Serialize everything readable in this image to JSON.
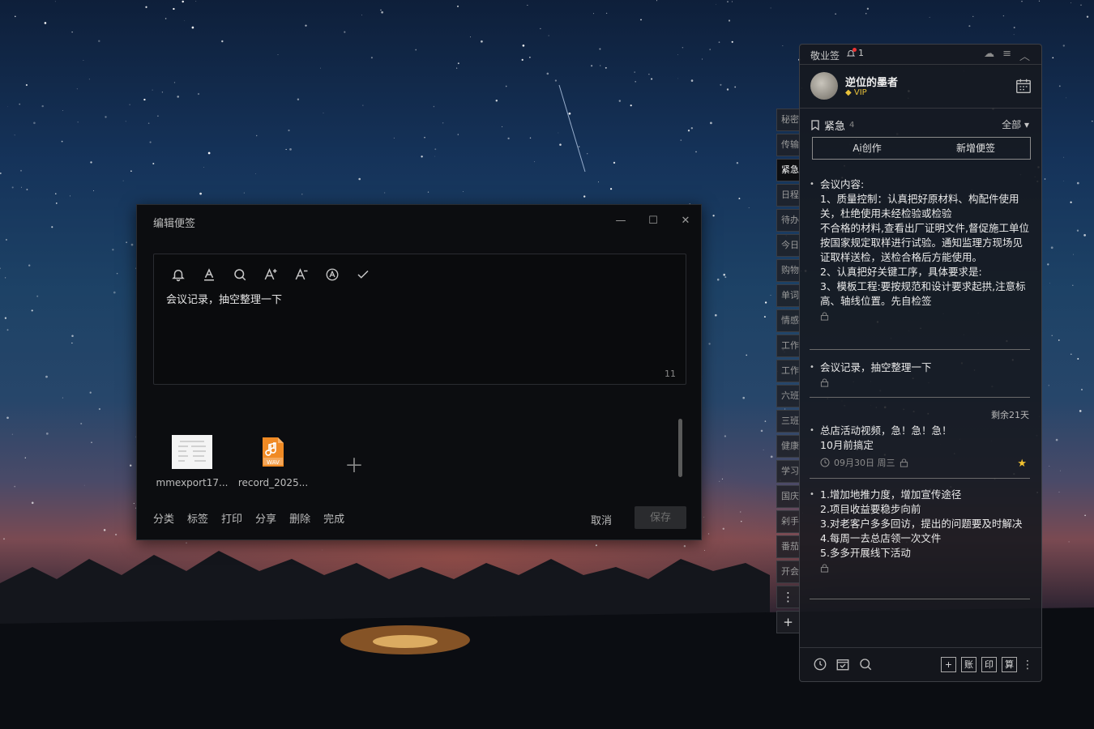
{
  "editor": {
    "title": "编辑便签",
    "text": "会议记录，抽空整理一下",
    "char_count": "11",
    "attachments": [
      {
        "name": "mmexport17...",
        "type": "image"
      },
      {
        "name": "record_2025...",
        "type": "wav",
        "badge": "WAV"
      }
    ],
    "footer_actions": [
      "分类",
      "标签",
      "打印",
      "分享",
      "删除",
      "完成"
    ],
    "cancel_label": "取消",
    "save_label": "保存",
    "format_tools": [
      "bell-icon",
      "underline-a-icon",
      "search-icon",
      "font-increase-icon",
      "font-decrease-icon",
      "circle-a-icon",
      "check-icon"
    ]
  },
  "side_tabs": [
    "秘密",
    "传输",
    "紧急",
    "日程",
    "待办",
    "今日",
    "购物",
    "单词",
    "情感",
    "工作",
    "工作",
    "六班",
    "三班",
    "健康",
    "学习",
    "国庆",
    "剁手",
    "番茄",
    "开会"
  ],
  "side_tab_icons": [
    "⋮",
    "+"
  ],
  "panel": {
    "app_name": "敬业签",
    "notify_count": "1",
    "user": {
      "name": "逆位的墨者",
      "badge": "VIP"
    },
    "category": {
      "name": "紧急",
      "count": "4"
    },
    "filter": "全部",
    "actions": [
      "Ai创作",
      "新增便签"
    ],
    "notes": [
      {
        "body": "会议内容:\n1、质量控制：认真把好原材料、构配件使用关，杜绝使用未经检验或检验\n不合格的材料,查看出厂证明文件,督促施工单位按国家规定取样进行试验。通知监理方现场见证取样送检，送检合格后方能使用。\n2、认真把好关键工序，具体要求是:\n3、模板工程:要按规范和设计要求起拱,注意标高、轴线位置。先自检签"
      },
      {
        "body": "会议记录，抽空整理一下"
      },
      {
        "body": "总店活动视频，急！急！急！\n10月前搞定",
        "date": "09月30日 周三",
        "remaining": "剩余21天"
      },
      {
        "body": "1.增加地推力度，增加宣传途径\n2.项目收益要稳步向前\n3.对老客户多多回访，提出的问题要及时解决\n4.每周一去总店领一次文件\n5.多多开展线下活动"
      }
    ],
    "bottom_buttons": [
      "账",
      "印",
      "算"
    ]
  },
  "colors": {
    "accent_star": "#f2c230",
    "vip": "#e8c13a",
    "wav": "#f08a24"
  }
}
